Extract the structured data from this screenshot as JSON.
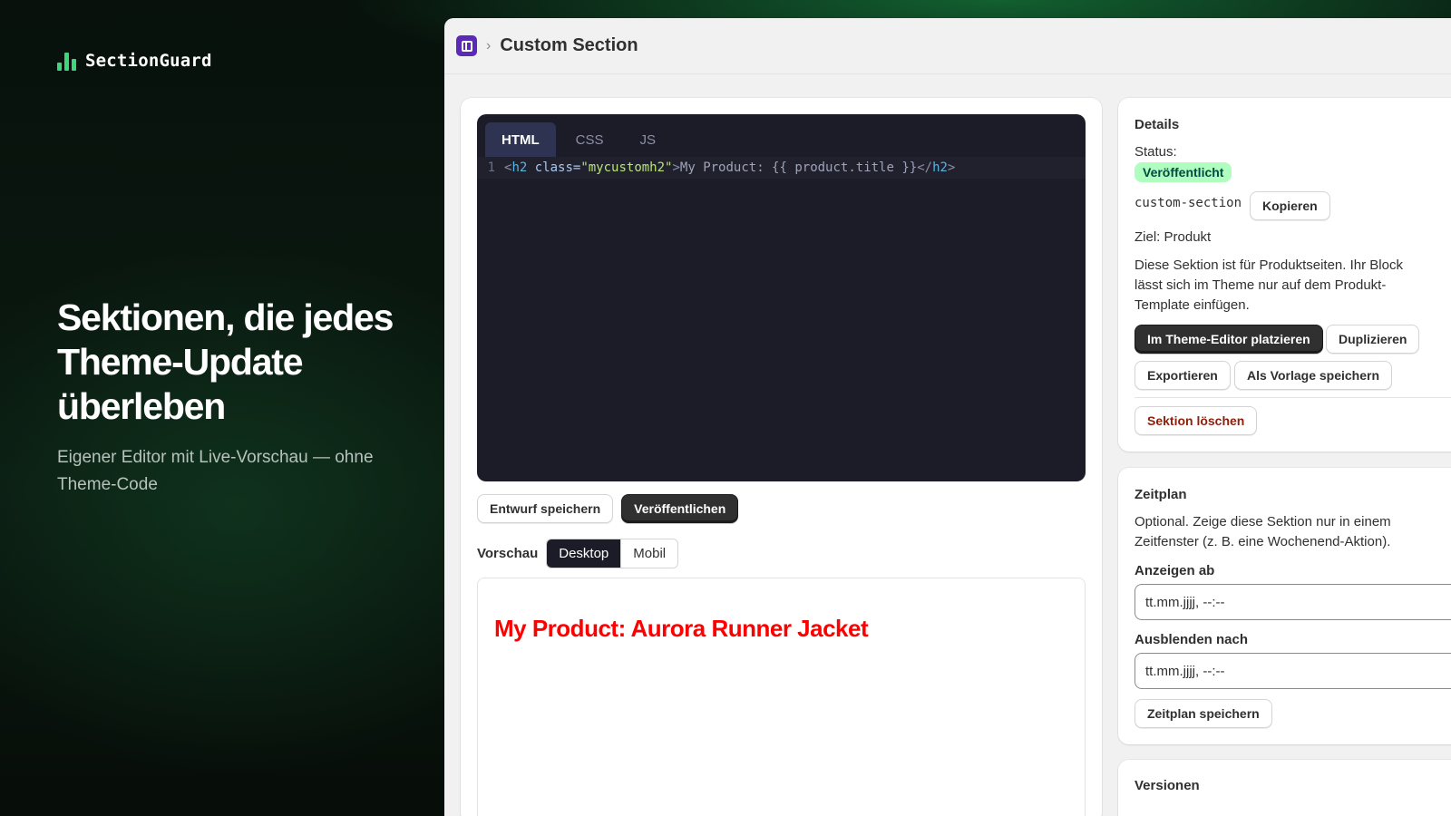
{
  "brand": {
    "name": "SectionGuard",
    "icon": "bar-chart-logo-icon",
    "accent": "#3ed67a"
  },
  "hero": {
    "title": "Sektionen, die jedes Theme-Update überleben",
    "subtitle": "Eigener Editor mit Live-Vorschau — ohne Theme-Code"
  },
  "app": {
    "icon": "section-app-icon",
    "breadcrumb_separator": "›",
    "title": "Custom Section"
  },
  "editor": {
    "tabs": [
      {
        "label": "HTML",
        "active": true
      },
      {
        "label": "CSS",
        "active": false
      },
      {
        "label": "JS",
        "active": false
      }
    ],
    "lines": [
      {
        "number": "1",
        "tokens": {
          "open_lt": "<",
          "tag": "h2",
          "attr": " class=",
          "value": "\"mycustomh2\"",
          "open_gt": ">",
          "text": "My Product: {{ product.title }}",
          "close_lt": "</",
          "close_tag": "h2",
          "close_gt": ">"
        }
      }
    ],
    "save_draft_label": "Entwurf speichern",
    "publish_label": "Veröffentlichen"
  },
  "preview": {
    "label": "Vorschau",
    "modes": [
      {
        "label": "Desktop",
        "active": true
      },
      {
        "label": "Mobil",
        "active": false
      }
    ],
    "heading": "My Product: Aurora Runner Jacket",
    "heading_color": "#ff0000"
  },
  "details": {
    "title": "Details",
    "status_label": "Status:",
    "status_badge": "Veröffentlicht",
    "handle": "custom-section",
    "copy_label": "Kopieren",
    "target": "Ziel: Produkt",
    "description": "Diese Sektion ist für Produktseiten. Ihr Block lässt sich im Theme nur auf dem Produkt-Template einfügen.",
    "place_label": "Im Theme-Editor platzieren",
    "duplicate_label": "Duplizieren",
    "export_label": "Exportieren",
    "save_template_label": "Als Vorlage speichern",
    "delete_label": "Sektion löschen"
  },
  "schedule": {
    "title": "Zeitplan",
    "description": "Optional. Zeige diese Sektion nur in einem Zeitfenster (z. B. eine Wochenend-Aktion).",
    "show_from_label": "Anzeigen ab",
    "show_from_value": "tt.mm.jjjj, --:--",
    "hide_after_label": "Ausblenden nach",
    "hide_after_value": "tt.mm.jjjj, --:--",
    "save_label": "Zeitplan speichern",
    "calendar_icon": "calendar-icon"
  },
  "versions": {
    "title": "Versionen"
  }
}
